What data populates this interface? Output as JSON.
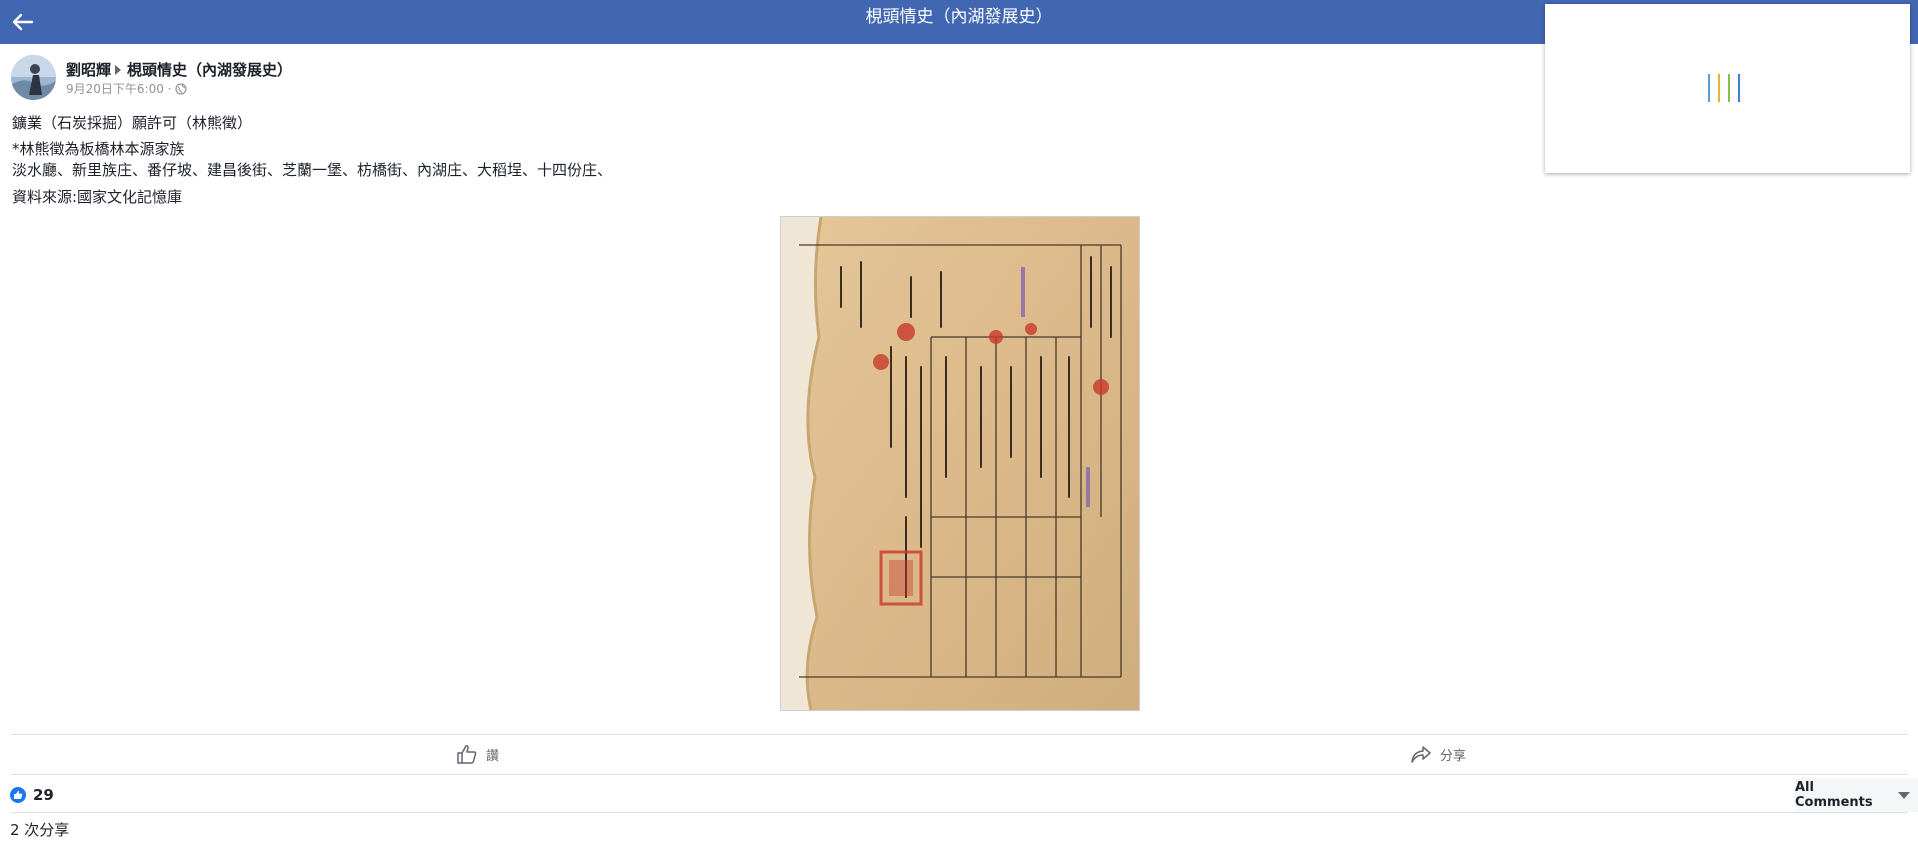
{
  "header": {
    "title": "梘頭情史（內湖發展史）",
    "back_icon": "back-arrow-icon"
  },
  "post": {
    "author": "劉昭輝",
    "group": "梘頭情史（內湖發展史）",
    "timestamp": "9月20日下午6:00 ·",
    "privacy_icon": "globe-icon",
    "text_lines": [
      "鑛業（石炭採掘）願許可（林熊徵）",
      "*林熊徵為板橋林本源家族",
      "淡水廳、新里族庄、番仔坡、建昌後街、芝蘭一堡、枋橋街、內湖庄、大稻埕、十四份庄、",
      "資料來源:國家文化記憶庫"
    ],
    "photo_alt": "historical-mining-permit-document"
  },
  "actions": {
    "like_label": "讚",
    "share_label": "分享"
  },
  "stats": {
    "likes": "29",
    "comments_filter": "All Comments",
    "shares": "2 次分享"
  },
  "colors": {
    "brand": "#4267b2",
    "like_blue": "#1877f2",
    "loader": [
      "#5b9bd5",
      "#e6b32e",
      "#8fb94a",
      "#3b7fd1"
    ]
  }
}
